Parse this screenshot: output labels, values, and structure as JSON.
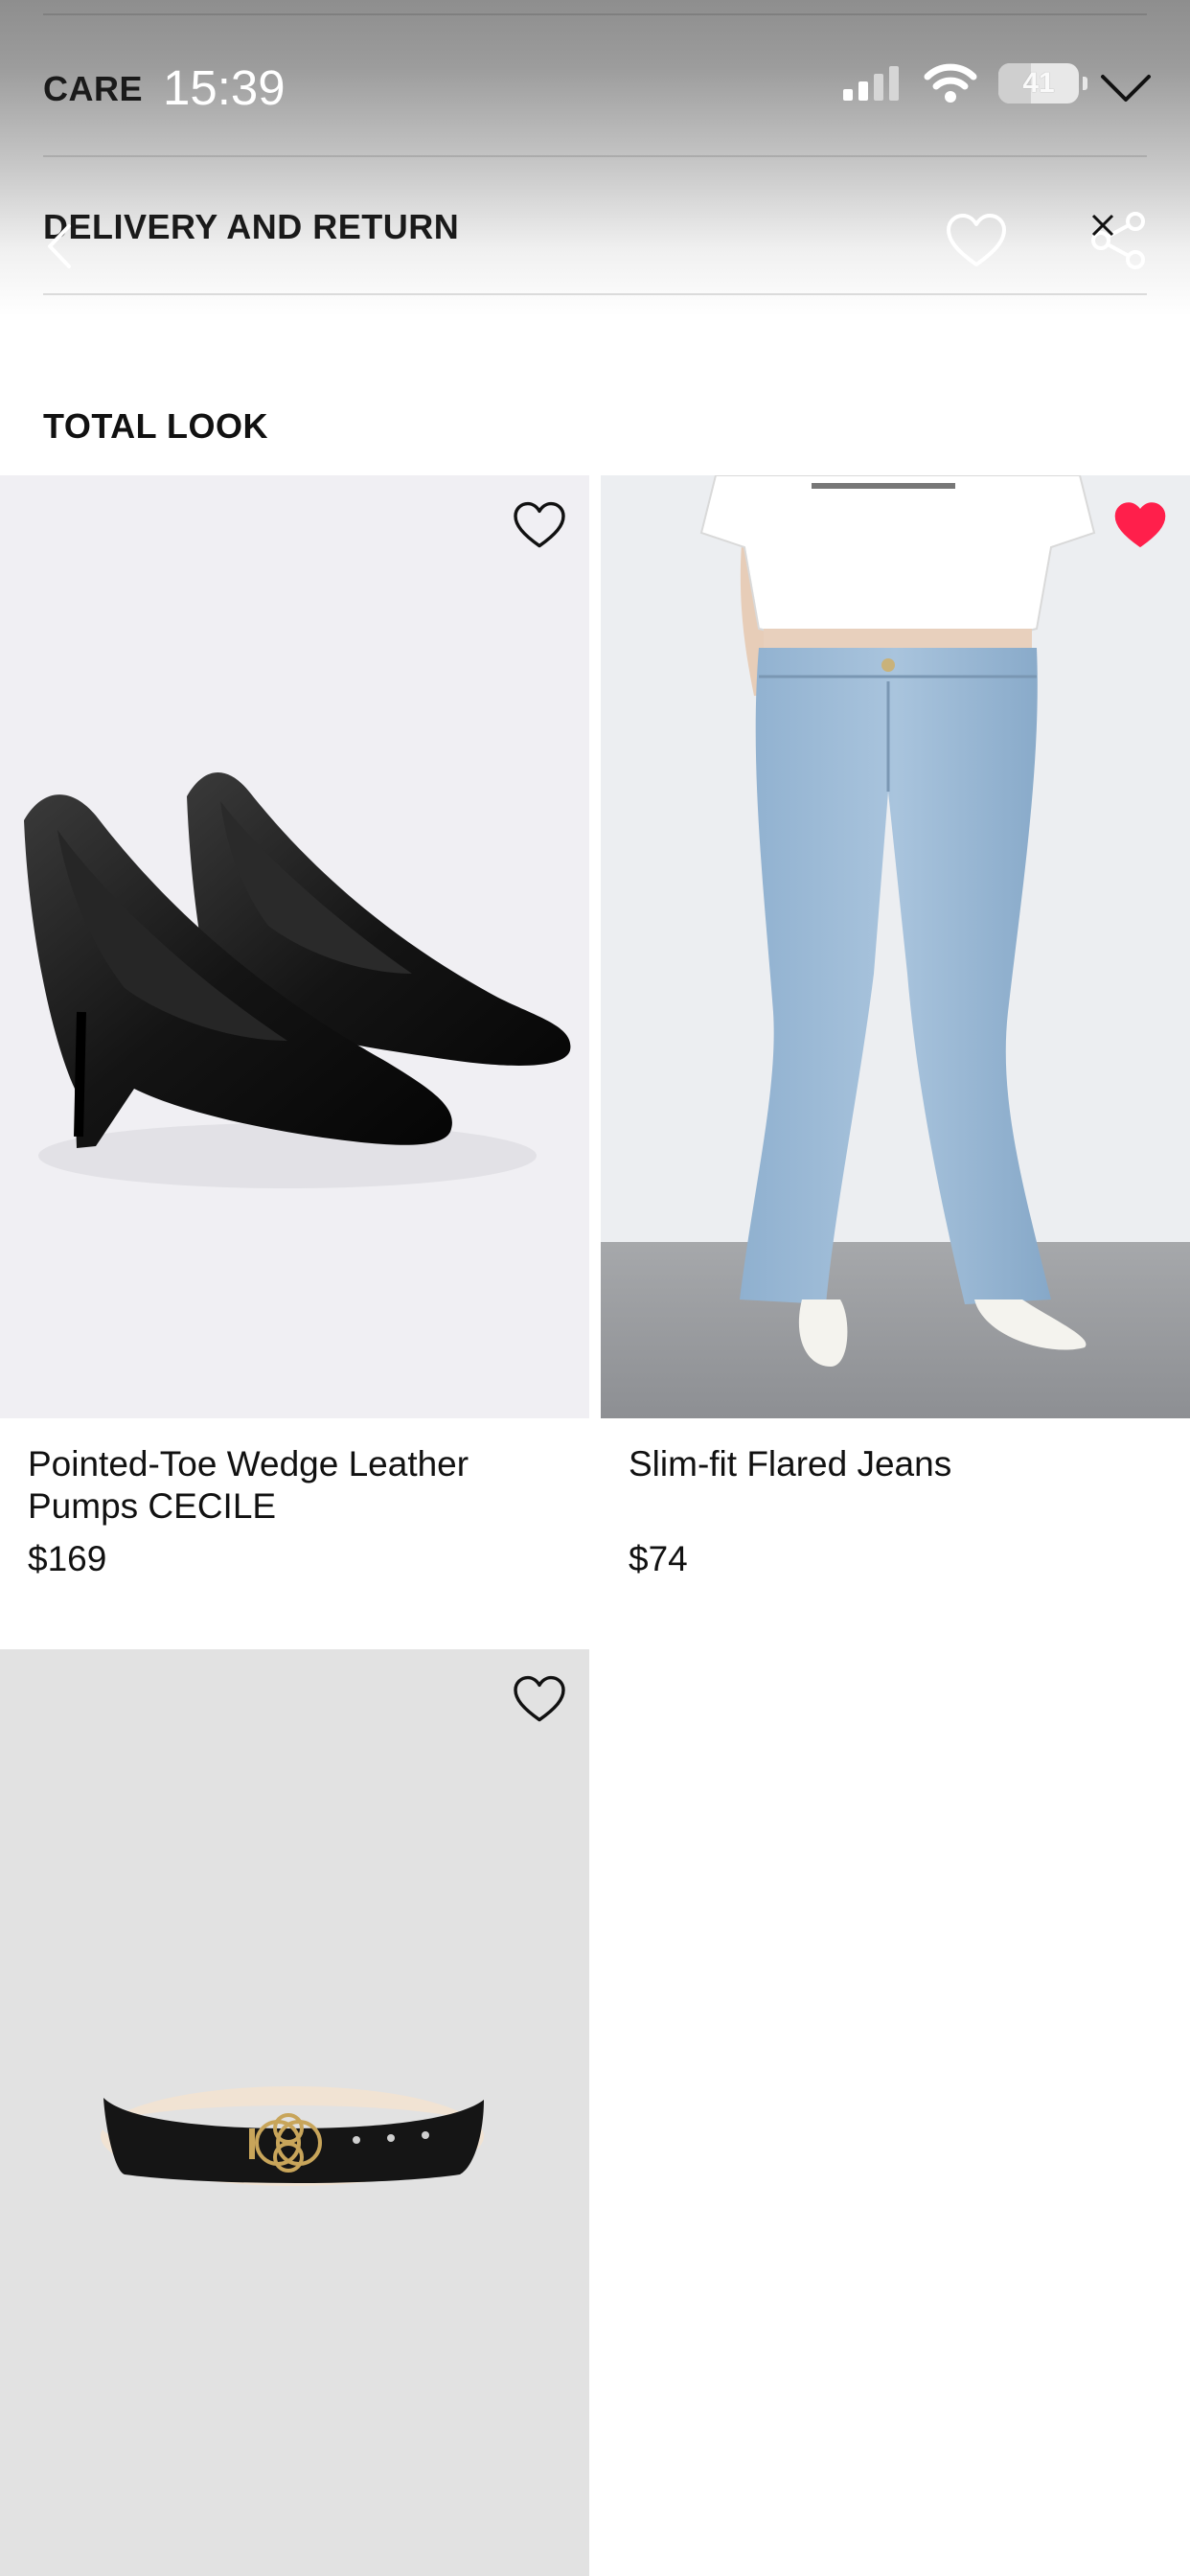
{
  "status_bar": {
    "time": "15:39",
    "battery": "41"
  },
  "accordion": {
    "care_label": "CARE",
    "delivery_label": "DELIVERY AND RETURN"
  },
  "section": {
    "title": "TOTAL LOOK"
  },
  "products": [
    {
      "name": "Pointed-Toe Wedge Leather Pumps CECILE",
      "price": "$169",
      "favorited": false,
      "image_icon": "black-wedge-pumps-image"
    },
    {
      "name": "Slim-fit Flared Jeans",
      "price": "$74",
      "favorited": true,
      "image_icon": "flared-jeans-image"
    },
    {
      "name": "",
      "price": "",
      "favorited": false,
      "image_icon": "black-leather-belt-image"
    }
  ],
  "colors": {
    "favorite_active": "#ff1f4b",
    "text": "#111111",
    "image_bg_light": "#f0eff3",
    "image_bg_grey": "#e2e2e2"
  }
}
